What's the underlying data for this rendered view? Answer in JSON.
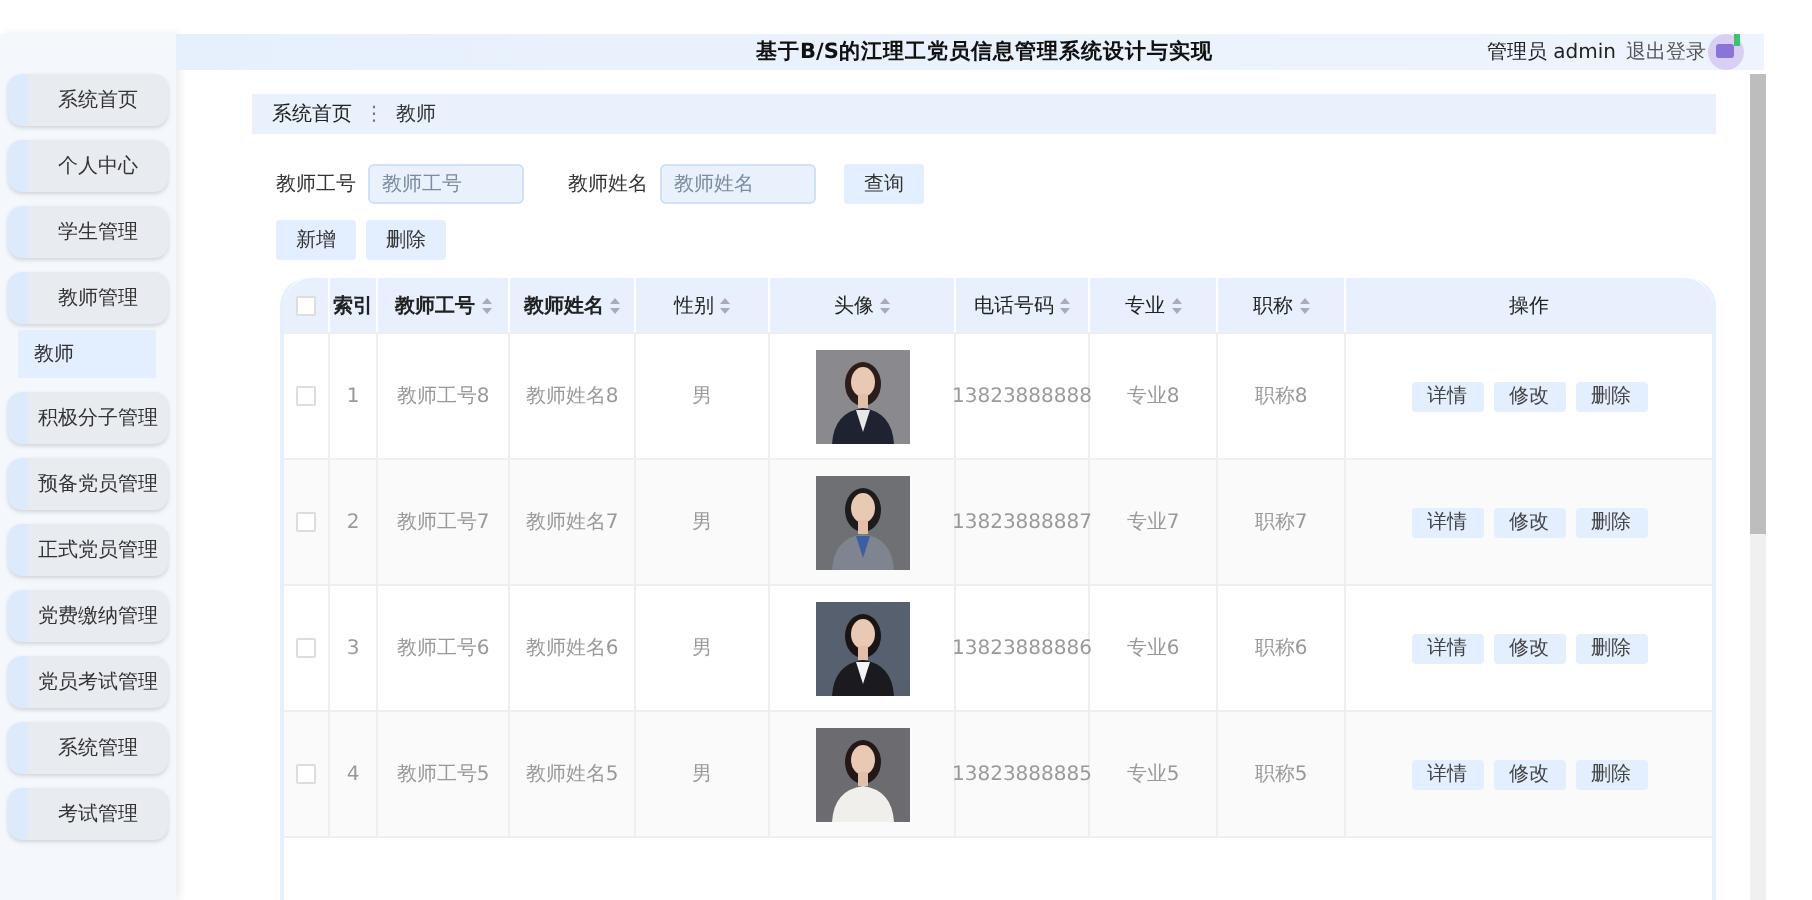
{
  "header": {
    "title": "基于B/S的江理工党员信息管理系统设计与实现",
    "user": "管理员 admin",
    "logout": "退出登录"
  },
  "sidebar": {
    "items": [
      {
        "label": "系统首页"
      },
      {
        "label": "个人中心"
      },
      {
        "label": "学生管理"
      },
      {
        "label": "教师管理",
        "children": [
          {
            "label": "教师",
            "selected": true
          }
        ]
      },
      {
        "label": "积极分子管理"
      },
      {
        "label": "预备党员管理"
      },
      {
        "label": "正式党员管理"
      },
      {
        "label": "党费缴纳管理"
      },
      {
        "label": "党员考试管理"
      },
      {
        "label": "系统管理"
      },
      {
        "label": "考试管理"
      }
    ]
  },
  "breadcrumb": {
    "items": [
      "系统首页",
      "教师"
    ],
    "separator": "⋮"
  },
  "search": {
    "fields": [
      {
        "label": "教师工号",
        "placeholder": "教师工号"
      },
      {
        "label": "教师姓名",
        "placeholder": "教师姓名"
      }
    ],
    "button": "查询"
  },
  "actions": [
    "新增",
    "删除"
  ],
  "table": {
    "select_all_checked": false,
    "columns": [
      {
        "label": "索引",
        "sortable": false
      },
      {
        "label": "教师工号",
        "sortable": true
      },
      {
        "label": "教师姓名",
        "sortable": true
      },
      {
        "label": "性别",
        "sortable": true
      },
      {
        "label": "头像",
        "sortable": true
      },
      {
        "label": "电话号码",
        "sortable": true
      },
      {
        "label": "专业",
        "sortable": true
      },
      {
        "label": "职称",
        "sortable": true
      },
      {
        "label": "操作",
        "sortable": false
      }
    ],
    "rows": [
      {
        "checked": false,
        "index": "1",
        "id": "教师工号8",
        "name": "教师姓名8",
        "gender": "男",
        "photo": {
          "kind": "picture"
        },
        "phone": "13823888888",
        "major": "专业8",
        "title": "职称8",
        "ops": [
          "详情",
          "修改",
          "删除"
        ]
      },
      {
        "checked": false,
        "index": "2",
        "id": "教师工号7",
        "name": "教师姓名7",
        "gender": "男",
        "photo": {
          "kind": "picture"
        },
        "phone": "13823888887",
        "major": "专业7",
        "title": "职称7",
        "ops": [
          "详情",
          "修改",
          "删除"
        ]
      },
      {
        "checked": false,
        "index": "3",
        "id": "教师工号6",
        "name": "教师姓名6",
        "gender": "男",
        "photo": {
          "kind": "picture"
        },
        "phone": "13823888886",
        "major": "专业6",
        "title": "职称6",
        "ops": [
          "详情",
          "修改",
          "删除"
        ]
      },
      {
        "checked": false,
        "index": "4",
        "id": "教师工号5",
        "name": "教师姓名5",
        "gender": "男",
        "photo": {
          "kind": "picture"
        },
        "phone": "13823888885",
        "major": "专业5",
        "title": "职称5",
        "ops": [
          "详情",
          "修改",
          "删除"
        ]
      }
    ]
  }
}
